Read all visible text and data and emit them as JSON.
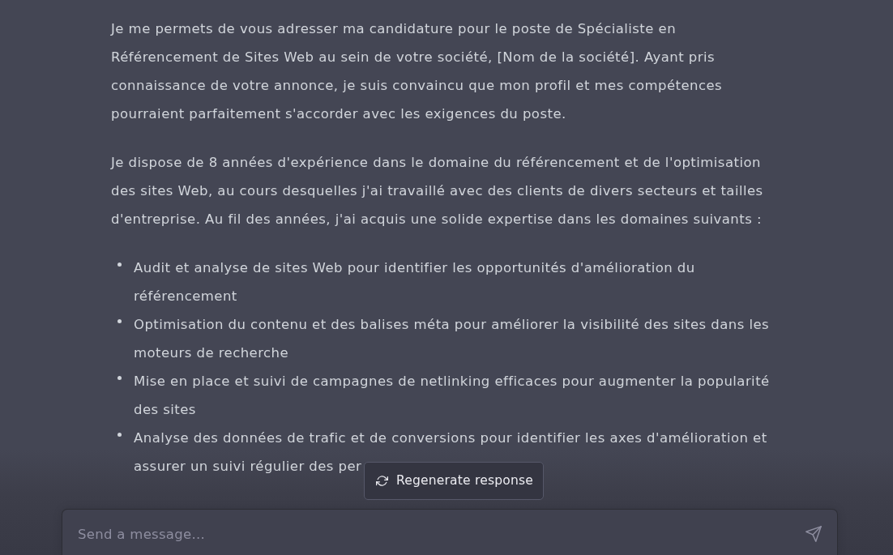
{
  "message": {
    "paragraphs": [
      "Je me permets de vous adresser ma candidature pour le poste de Spécialiste en Référencement de Sites Web au sein de votre société, [Nom de la société]. Ayant pris connaissance de votre annonce, je suis convaincu que mon profil et mes compétences pourraient parfaitement s'accorder avec les exigences du poste.",
      "Je dispose de 8 années d'expérience dans le domaine du référencement et de l'optimisation des sites Web, au cours desquelles j'ai travaillé avec des clients de divers secteurs et tailles d'entreprise. Au fil des années, j'ai acquis une solide expertise dans les domaines suivants :"
    ],
    "bullets": [
      "Audit et analyse de sites Web pour identifier les opportunités d'amélioration du référencement",
      "Optimisation du contenu et des balises méta pour améliorer la visibilité des sites dans les moteurs de recherche",
      "Mise en place et suivi de campagnes de netlinking efficaces pour augmenter la popularité des sites",
      "Analyse des données de trafic et de conversions pour identifier les axes d'amélioration et assurer un suivi régulier des per"
    ]
  },
  "regenerate_button": {
    "label": "Regenerate response"
  },
  "composer": {
    "placeholder": "Send a message..."
  }
}
